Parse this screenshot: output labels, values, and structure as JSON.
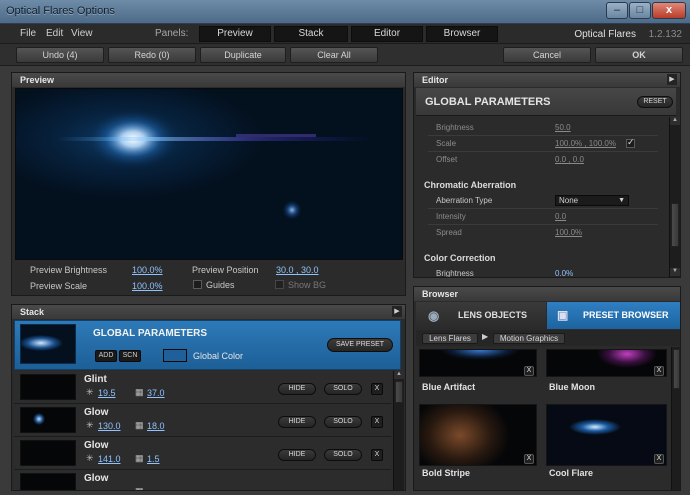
{
  "window": {
    "title": "Optical Flares Options",
    "minimize": "–",
    "maximize": "□",
    "close": "x"
  },
  "menu": {
    "items": [
      "File",
      "Edit",
      "View"
    ],
    "panels_label": "Panels:",
    "panel_tabs": [
      "Preview",
      "Stack",
      "Editor",
      "Browser"
    ],
    "app_name": "Optical Flares",
    "app_version": "1.2.132"
  },
  "toolbar": {
    "undo": "Undo (4)",
    "redo": "Redo (0)",
    "duplicate": "Duplicate",
    "clear_all": "Clear All",
    "cancel": "Cancel",
    "ok": "OK"
  },
  "preview": {
    "title": "Preview",
    "brightness_label": "Preview Brightness",
    "brightness_value": "100.0%",
    "position_label": "Preview Position",
    "position_value": "30.0 , 30.0",
    "scale_label": "Preview Scale",
    "scale_value": "100.0%",
    "guides_label": "Guides",
    "showbg_label": "Show BG"
  },
  "stack": {
    "title": "Stack",
    "global": {
      "title": "GLOBAL PARAMETERS",
      "add": "ADD",
      "scn": "SCN",
      "global_color_label": "Global Color",
      "global_color": "#1f5f9a",
      "save_preset": "SAVE PRESET"
    },
    "hide": "HIDE",
    "solo": "SOLO",
    "remove": "X",
    "rows": [
      {
        "name": "Glint",
        "count": "19.5",
        "size": "37.0"
      },
      {
        "name": "Glow",
        "count": "130.0",
        "size": "18.0"
      },
      {
        "name": "Glow",
        "count": "141.0",
        "size": "1.5"
      },
      {
        "name": "Glow",
        "count": "",
        "size": ""
      }
    ]
  },
  "editor": {
    "title": "Editor",
    "heading": "GLOBAL PARAMETERS",
    "reset": "RESET",
    "brightness_label": "Brightness",
    "brightness_value": "50.0",
    "scale_label": "Scale",
    "scale_value": "100.0% , 100.0%",
    "offset_label": "Offset",
    "offset_value": "0.0 , 0.0",
    "chromatic_heading": "Chromatic Aberration",
    "aberration_type_label": "Aberration Type",
    "aberration_type_value": "None",
    "intensity_label": "Intensity",
    "intensity_value": "0.0",
    "spread_label": "Spread",
    "spread_value": "100.0%",
    "color_correction_heading": "Color Correction",
    "cc_brightness_label": "Brightness",
    "cc_brightness_value": "0.0%"
  },
  "browser": {
    "title": "Browser",
    "tab_lens_objects": "LENS OBJECTS",
    "tab_preset_browser": "PRESET BROWSER",
    "crumb_root": "Lens Flares",
    "crumb_child": "Motion Graphics",
    "tiles": [
      "Blue Artifact",
      "Blue Moon",
      "Bold Stripe",
      "Cool Flare"
    ],
    "remove": "X"
  },
  "colors": {
    "accent_blue": "#2a74b3",
    "link_blue": "#8fc3ff"
  }
}
